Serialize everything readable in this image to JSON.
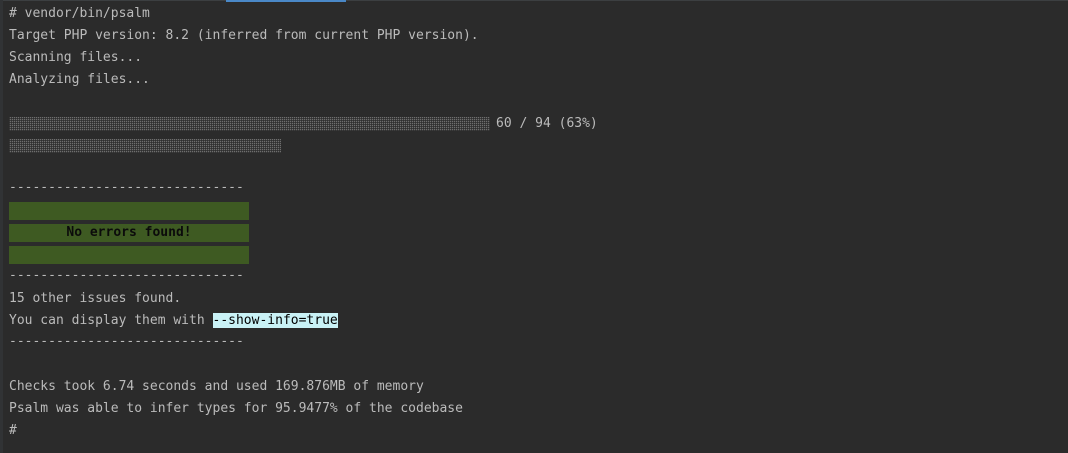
{
  "terminal": {
    "command_line": "# vendor/bin/psalm",
    "target_php": "Target PHP version: 8.2 (inferred from current PHP version).",
    "scanning": "Scanning files...",
    "analyzing": "Analyzing files...",
    "progress": {
      "label": "60 / 94 (63%)",
      "done": 60,
      "total": 94,
      "percent": 63
    },
    "divider": "------------------------------",
    "success_message": "No errors found!",
    "other_issues": "15 other issues found.",
    "display_hint_prefix": "You can display them with ",
    "display_hint_flag": "--show-info=true",
    "checks_summary": "Checks took 6.74 seconds and used 169.876MB of memory",
    "infer_summary": "Psalm was able to infer types for 95.9477% of the codebase",
    "prompt": "#"
  },
  "colors": {
    "background": "#2b2b2b",
    "text": "#bbbbbb",
    "success_block": "#3e5a22",
    "flag_highlight": "#c9f2f6",
    "active_tab": "#4a88c7"
  }
}
